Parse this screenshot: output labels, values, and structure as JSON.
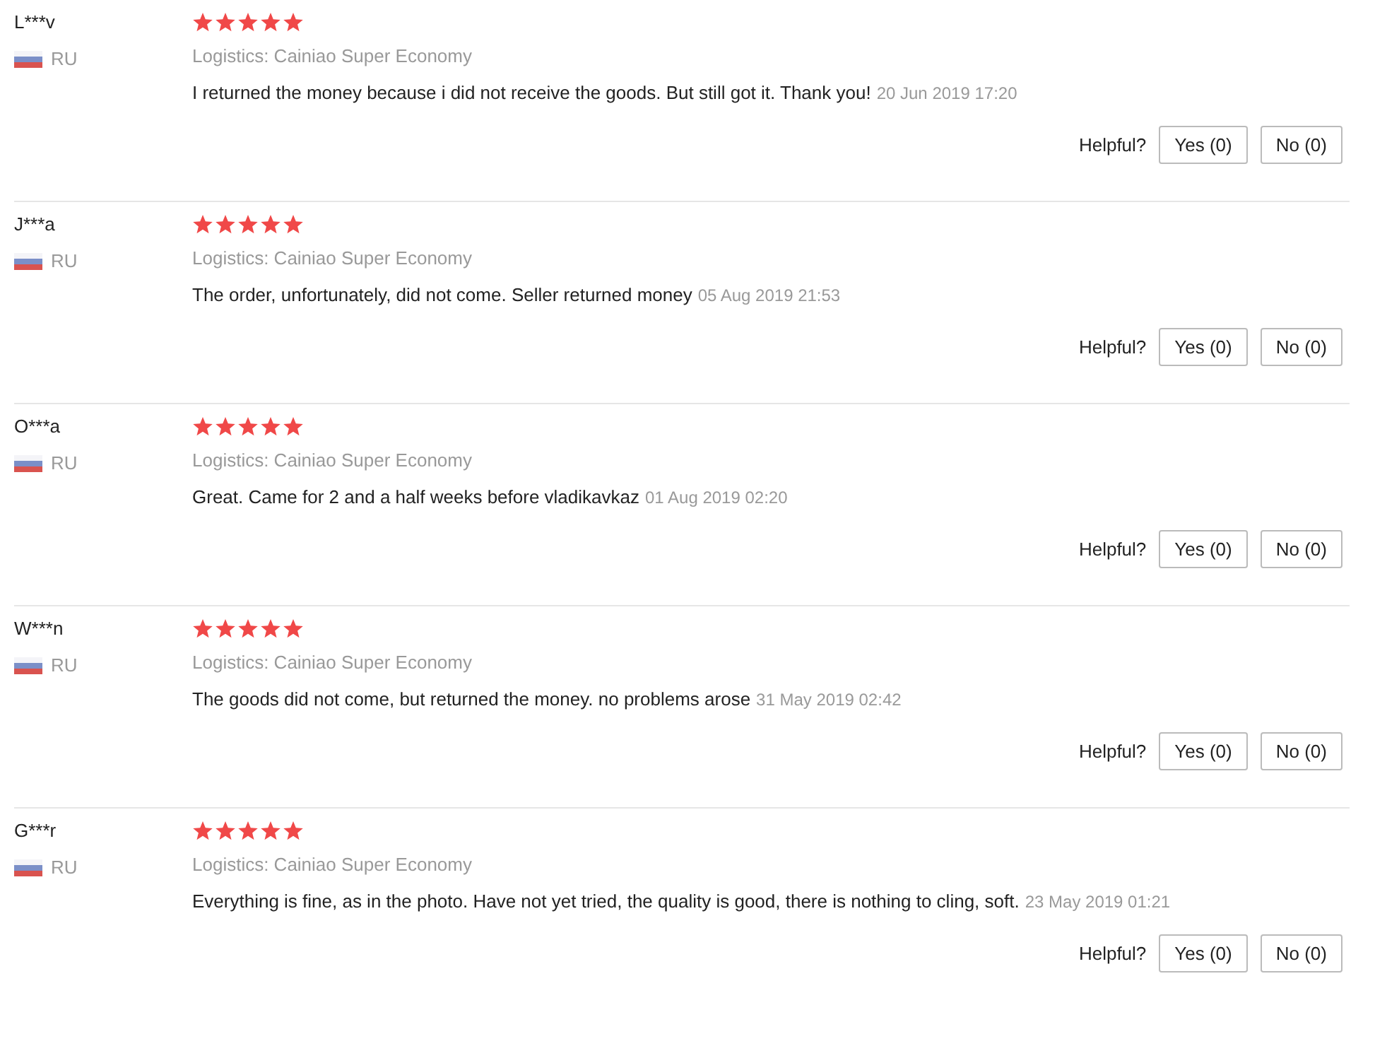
{
  "reviews": [
    {
      "name": "L***v",
      "country": "RU",
      "stars": 5,
      "logistics": "Logistics: Cainiao Super Economy",
      "text": "I returned the money because i did not receive the goods. But still got it. Thank you!",
      "date": "20 Jun 2019 17:20",
      "helpful": "Helpful?",
      "yes": "Yes (0)",
      "no": "No (0)"
    },
    {
      "name": "J***a",
      "country": "RU",
      "stars": 5,
      "logistics": "Logistics: Cainiao Super Economy",
      "text": "The order, unfortunately, did not come. Seller returned money",
      "date": "05 Aug 2019 21:53",
      "helpful": "Helpful?",
      "yes": "Yes (0)",
      "no": "No (0)"
    },
    {
      "name": "O***a",
      "country": "RU",
      "stars": 5,
      "logistics": "Logistics: Cainiao Super Economy",
      "text": "Great. Came for 2 and a half weeks before vladikavkaz",
      "date": "01 Aug 2019 02:20",
      "helpful": "Helpful?",
      "yes": "Yes (0)",
      "no": "No (0)"
    },
    {
      "name": "W***n",
      "country": "RU",
      "stars": 5,
      "logistics": "Logistics: Cainiao Super Economy",
      "text": "The goods did not come, but returned the money. no problems arose",
      "date": "31 May 2019 02:42",
      "helpful": "Helpful?",
      "yes": "Yes (0)",
      "no": "No (0)"
    },
    {
      "name": "G***r",
      "country": "RU",
      "stars": 5,
      "logistics": "Logistics: Cainiao Super Economy",
      "text": "Everything is fine, as in the photo. Have not yet tried, the quality is good, there is nothing to cling, soft.",
      "date": "23 May 2019 01:21",
      "helpful": "Helpful?",
      "yes": "Yes (0)",
      "no": "No (0)"
    }
  ]
}
